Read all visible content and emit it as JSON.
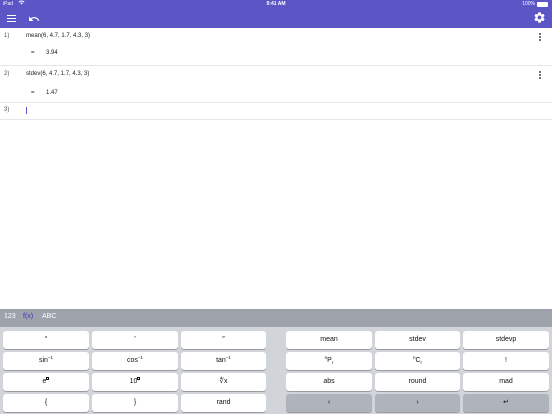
{
  "status_bar": {
    "device": "iPad",
    "time": "9:41 AM",
    "battery": "100%"
  },
  "toolbar": {
    "menu_icon": "hamburger-menu-icon",
    "undo_icon": "undo-icon",
    "settings_icon": "gear-icon"
  },
  "expressions": [
    {
      "number": "1)",
      "input": "mean(6, 4.7, 1.7, 4.3, 3)",
      "eq": "=",
      "result": "3.94"
    },
    {
      "number": "2)",
      "input": "stdev(6, 4.7, 1.7, 4.3, 3)",
      "eq": "=",
      "result": "1.47"
    },
    {
      "number": "3)",
      "input": ""
    }
  ],
  "keyboard": {
    "tabs": [
      "123",
      "f(x)",
      "ABC"
    ],
    "active_tab": "f(x)",
    "keys": {
      "degree": "°",
      "minute": "′",
      "second": "″",
      "arcsin": "sin",
      "arccos": "cos",
      "arctan": "tan",
      "inverse_sup": "−1",
      "exp_base": "e",
      "pow10_base": "10",
      "nthroot": "∜x",
      "brace_open": "{",
      "brace_close": "}",
      "rand": "rand",
      "mean": "mean",
      "stdev": "stdev",
      "stdevp": "stdevp",
      "npr_n": "n",
      "npr_p": "P",
      "npr_r": "r",
      "ncr_n": "n",
      "ncr_c": "C",
      "ncr_r": "r",
      "factorial": "!",
      "abs": "abs",
      "round": "round",
      "mad": "mad",
      "left": "‹",
      "right": "›",
      "enter": "↵"
    }
  },
  "colors": {
    "accent": "#5c55c5",
    "keyboard_bg": "#d1d4d9",
    "tab_bar_bg": "#9ea3ab"
  }
}
